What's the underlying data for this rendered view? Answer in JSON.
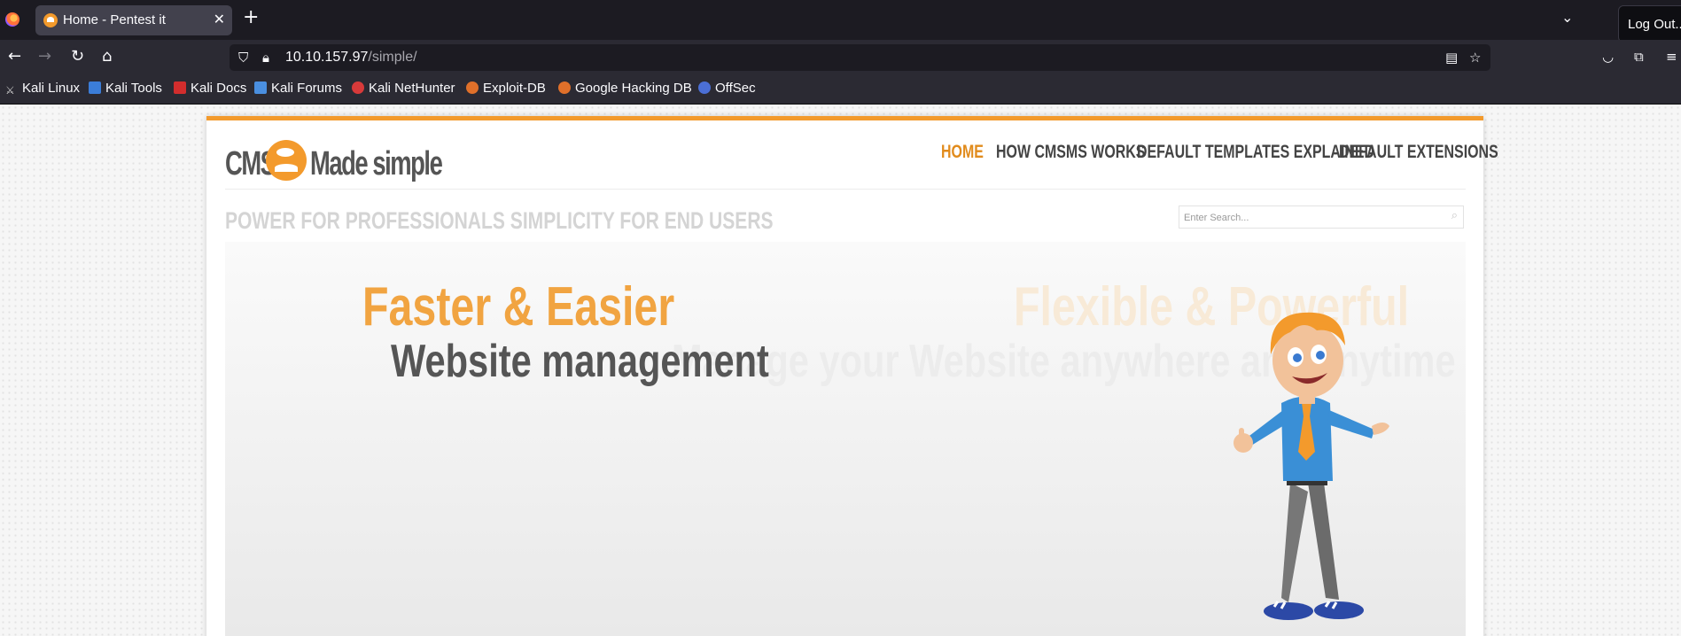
{
  "browser": {
    "tab_title": "Home - Pentest it",
    "tooltip": "Log Out...",
    "url_host": "10.10.157.97",
    "url_path": "/simple/",
    "bookmarks": [
      {
        "label": "Kali Linux",
        "color": "#c7c7c7"
      },
      {
        "label": "Kali Tools",
        "color": "#3b7dd8"
      },
      {
        "label": "Kali Docs",
        "color": "#d22d2d"
      },
      {
        "label": "Kali Forums",
        "color": "#4a8fe0"
      },
      {
        "label": "Kali NetHunter",
        "color": "#d83a3a"
      },
      {
        "label": "Exploit-DB",
        "color": "#e0702a"
      },
      {
        "label": "Google Hacking DB",
        "color": "#e0702a"
      },
      {
        "label": "OffSec",
        "color": "#4b6fd6"
      }
    ]
  },
  "site": {
    "logo_left": "CMS",
    "logo_right": "Made simple",
    "accent": "#f39a2c",
    "menu": [
      {
        "label": "HOME",
        "active": true
      },
      {
        "label": "HOW CMSMS WORKS",
        "active": false
      },
      {
        "label": "DEFAULT TEMPLATES EXPLAINED",
        "active": false
      },
      {
        "label": "DEFAULT EXTENSIONS",
        "active": false
      }
    ],
    "tagline": "POWER FOR PROFESSIONALS SIMPLICITY FOR END USERS",
    "search_placeholder": "Enter Search...",
    "banner": {
      "heading": "Faster & Easier",
      "subheading": "Website management",
      "heading_next": "Flexible & Powerful",
      "subheading_next": "Manage your Website anywhere and anytime"
    }
  }
}
